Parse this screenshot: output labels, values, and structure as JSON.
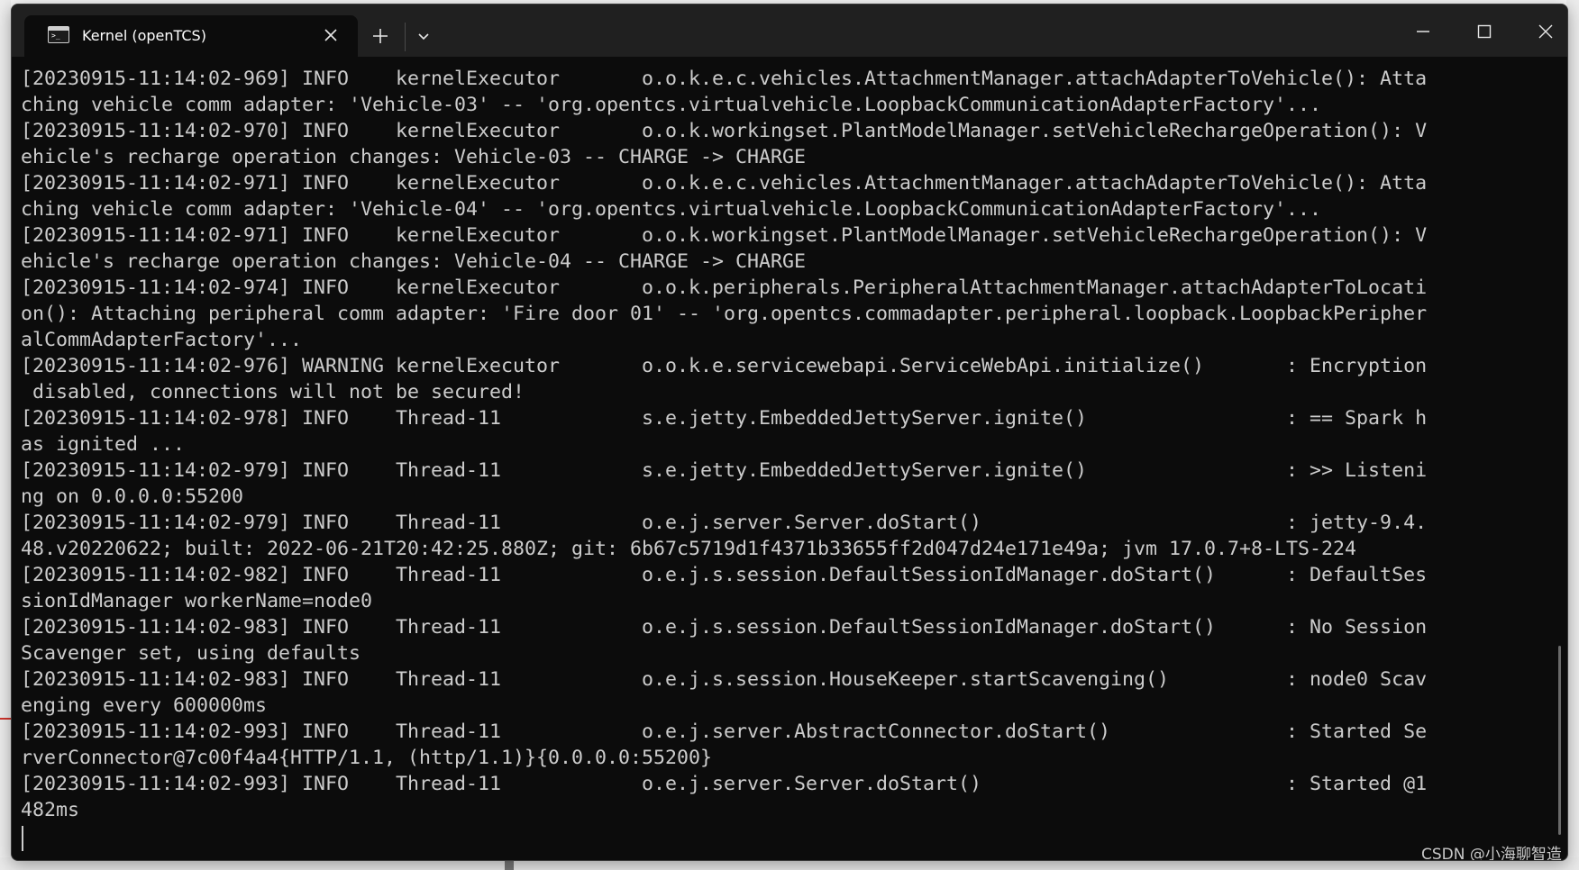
{
  "window": {
    "tab_title": "Kernel (openTCS)",
    "tab_icon": "terminal-icon",
    "buttons": {
      "close_tab": "✕",
      "new_tab": "+",
      "dropdown": "chevron-down-icon",
      "minimize": "minimize-icon",
      "maximize": "maximize-icon",
      "close": "close-icon"
    }
  },
  "terminal": {
    "background": "#0c0c0c",
    "foreground": "#cccccc",
    "lines": [
      "[20230915-11:14:02-969] INFO    kernelExecutor       o.o.k.e.c.vehicles.AttachmentManager.attachAdapterToVehicle(): Atta",
      "ching vehicle comm adapter: 'Vehicle-03' -- 'org.opentcs.virtualvehicle.LoopbackCommunicationAdapterFactory'...",
      "[20230915-11:14:02-970] INFO    kernelExecutor       o.o.k.workingset.PlantModelManager.setVehicleRechargeOperation(): V",
      "ehicle's recharge operation changes: Vehicle-03 -- CHARGE -> CHARGE",
      "[20230915-11:14:02-971] INFO    kernelExecutor       o.o.k.e.c.vehicles.AttachmentManager.attachAdapterToVehicle(): Atta",
      "ching vehicle comm adapter: 'Vehicle-04' -- 'org.opentcs.virtualvehicle.LoopbackCommunicationAdapterFactory'...",
      "[20230915-11:14:02-971] INFO    kernelExecutor       o.o.k.workingset.PlantModelManager.setVehicleRechargeOperation(): V",
      "ehicle's recharge operation changes: Vehicle-04 -- CHARGE -> CHARGE",
      "[20230915-11:14:02-974] INFO    kernelExecutor       o.o.k.peripherals.PeripheralAttachmentManager.attachAdapterToLocati",
      "on(): Attaching peripheral comm adapter: 'Fire door 01' -- 'org.opentcs.commadapter.peripheral.loopback.LoopbackPeripher",
      "alCommAdapterFactory'...",
      "[20230915-11:14:02-976] WARNING kernelExecutor       o.o.k.e.servicewebapi.ServiceWebApi.initialize()       : Encryption",
      " disabled, connections will not be secured!",
      "[20230915-11:14:02-978] INFO    Thread-11            s.e.jetty.EmbeddedJettyServer.ignite()                 : == Spark h",
      "as ignited ...",
      "[20230915-11:14:02-979] INFO    Thread-11            s.e.jetty.EmbeddedJettyServer.ignite()                 : >> Listeni",
      "ng on 0.0.0.0:55200",
      "[20230915-11:14:02-979] INFO    Thread-11            o.e.j.server.Server.doStart()                          : jetty-9.4.",
      "48.v20220622; built: 2022-06-21T20:42:25.880Z; git: 6b67c5719d1f4371b33655ff2d047d24e171e49a; jvm 17.0.7+8-LTS-224",
      "[20230915-11:14:02-982] INFO    Thread-11            o.e.j.s.session.DefaultSessionIdManager.doStart()      : DefaultSes",
      "sionIdManager workerName=node0",
      "[20230915-11:14:02-983] INFO    Thread-11            o.e.j.s.session.DefaultSessionIdManager.doStart()      : No Session",
      "Scavenger set, using defaults",
      "[20230915-11:14:02-983] INFO    Thread-11            o.e.j.s.session.HouseKeeper.startScavenging()          : node0 Scav",
      "enging every 600000ms",
      "[20230915-11:14:02-993] INFO    Thread-11            o.e.j.server.AbstractConnector.doStart()               : Started Se",
      "rverConnector@7c00f4a4{HTTP/1.1, (http/1.1)}{0.0.0.0:55200}",
      "[20230915-11:14:02-993] INFO    Thread-11            o.e.j.server.Server.doStart()                          : Started @1",
      "482ms"
    ]
  },
  "watermark": "CSDN @小海聊智造"
}
